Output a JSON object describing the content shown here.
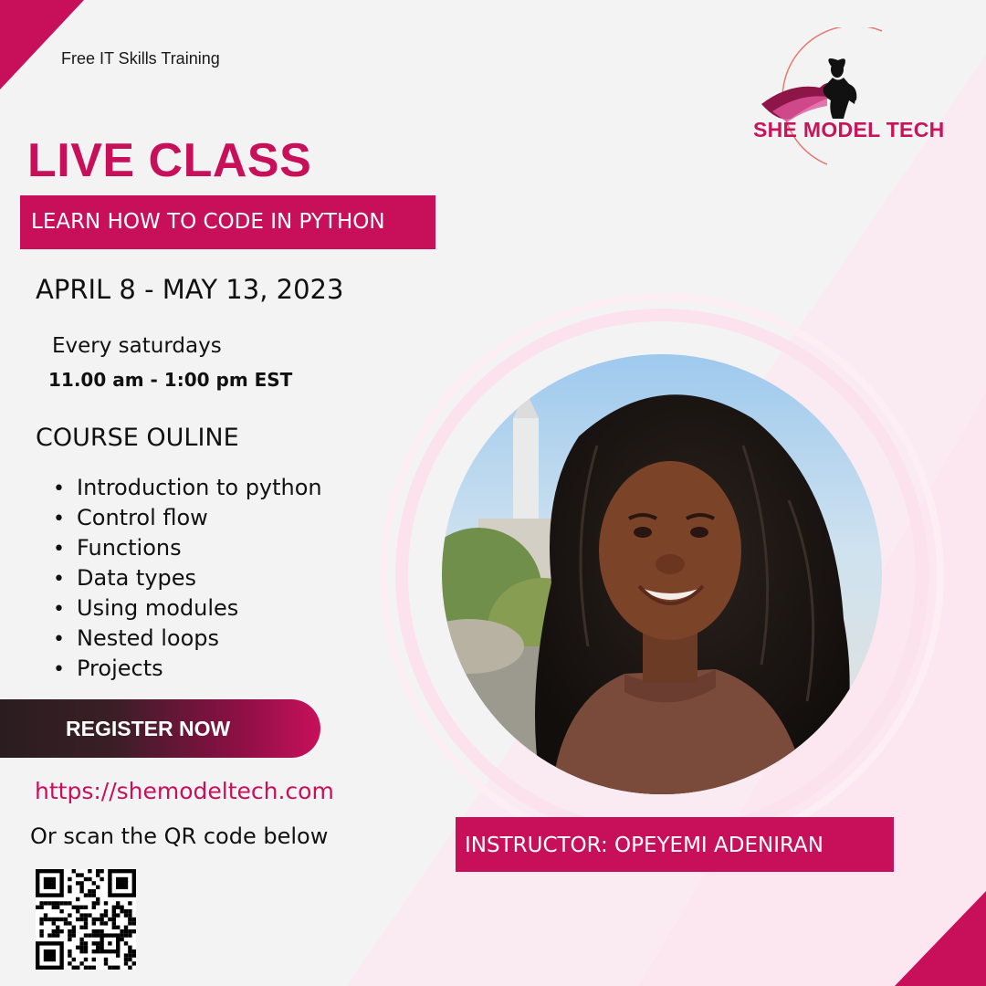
{
  "tagline": "Free IT Skills Training",
  "brand": {
    "name": "SHE MODEL TECH",
    "logo_icon": "woman-silhouette-logo-icon"
  },
  "headline": "LIVE CLASS",
  "subhead": "LEARN HOW TO CODE IN PYTHON",
  "schedule": {
    "dates": "APRIL 8 - MAY 13, 2023",
    "days": "Every saturdays",
    "time": "11.00 am - 1:00 pm EST"
  },
  "outline": {
    "title": "COURSE OULINE",
    "items": [
      "Introduction to python",
      "Control flow",
      "Functions",
      "Data types",
      "Using modules",
      "Nested loops",
      "Projects"
    ]
  },
  "cta": {
    "label": "REGISTER NOW",
    "url": "https://shemodeltech.com",
    "scan_text": "Or scan the QR code below"
  },
  "instructor": "INSTRUCTOR: OPEYEMI ADENIRAN",
  "colors": {
    "accent": "#c8105a",
    "background": "#f4f3f4",
    "soft_pink": "#fce8f0",
    "dark": "#2a1d1f"
  }
}
